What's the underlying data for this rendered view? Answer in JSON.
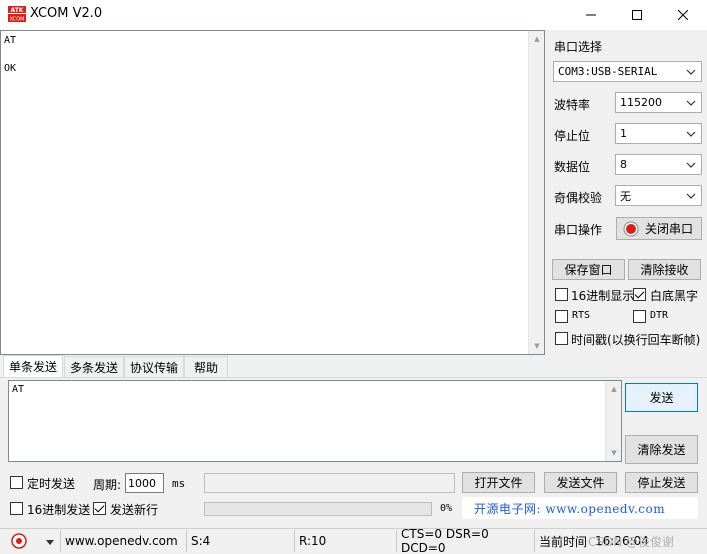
{
  "window": {
    "title": "XCOM V2.0",
    "logo_text": "ATK XCOM"
  },
  "receive": {
    "content": "AT\n\nOK"
  },
  "serial": {
    "port_label": "串口选择",
    "port_value": "COM3:USB-SERIAL",
    "baud_label": "波特率",
    "baud_value": "115200",
    "stop_label": "停止位",
    "stop_value": "1",
    "data_label": "数据位",
    "data_value": "8",
    "parity_label": "奇偶校验",
    "parity_value": "无",
    "op_label": "串口操作",
    "op_button": "关闭串口"
  },
  "recv_options": {
    "save_window": "保存窗口",
    "clear_recv": "清除接收",
    "hex_display": "16进制显示",
    "white_black": "白底黑字",
    "rts": "RTS",
    "dtr": "DTR",
    "timestamp": "时间戳(以换行回车断帧)"
  },
  "tabs": [
    "单条发送",
    "多条发送",
    "协议传输",
    "帮助"
  ],
  "send": {
    "content": "AT",
    "send_button": "发送",
    "clear_send": "清除发送",
    "timed_send": "定时发送",
    "period_label": "周期:",
    "period_value": "1000",
    "period_unit": "ms",
    "open_file": "打开文件",
    "send_file": "发送文件",
    "stop_send": "停止发送",
    "hex_send": "16进制发送",
    "send_newline": "发送新行",
    "progress_text": "0%",
    "progress_value": 0,
    "promo": "开源电子网: www.openedv.com"
  },
  "status": {
    "website": "www.openedv.com",
    "sent": "S:4",
    "received": "R:10",
    "lines": "CTS=0 DSR=0 DCD=0",
    "time_label": "当前时间",
    "time_value": "16:26:04",
    "watermark": "CSDN @俊俊谢"
  },
  "colors": {
    "accent": "#1e5bd6",
    "record_red": "#d8201b",
    "primary_border": "#0078d7"
  }
}
